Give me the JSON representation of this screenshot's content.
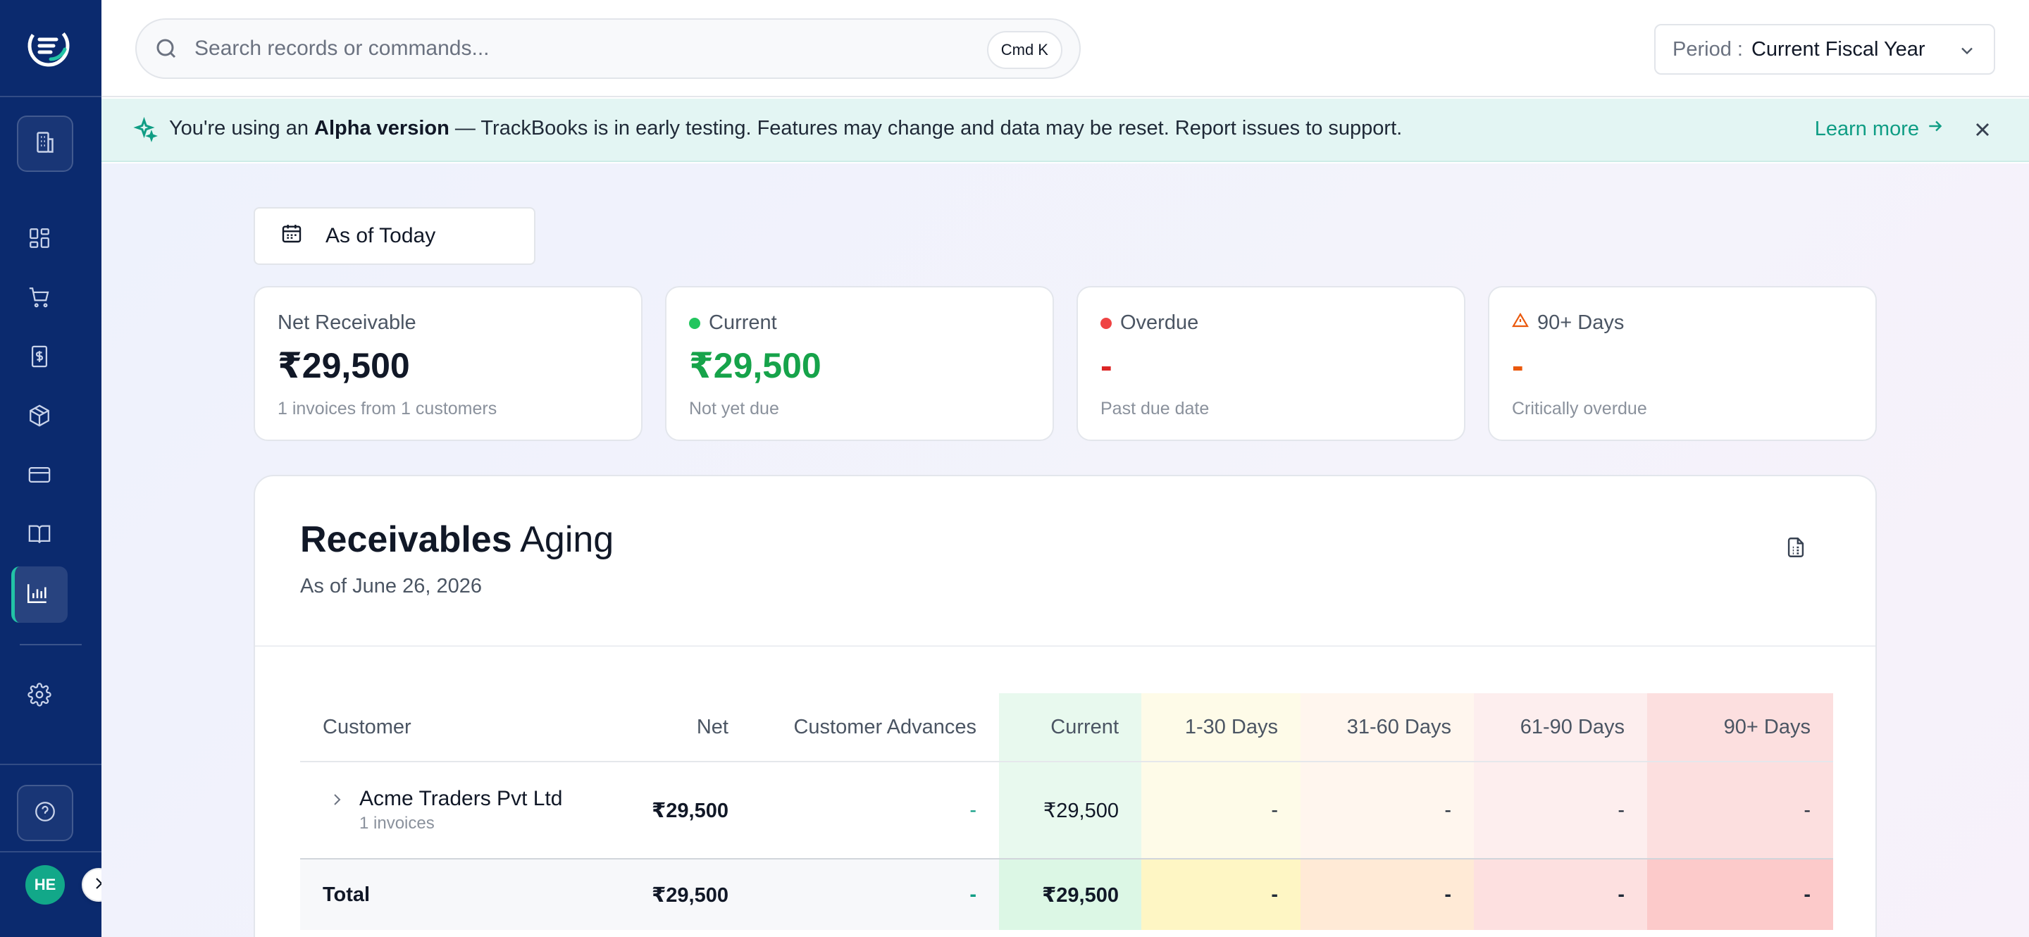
{
  "app": {
    "name": "TrackBooks",
    "user_initials": "HE"
  },
  "sidebar": {
    "items": [
      {
        "name": "organization",
        "icon": "building-icon"
      },
      {
        "name": "dashboard",
        "icon": "dashboard-grid-icon"
      },
      {
        "name": "sales",
        "icon": "shopping-cart-icon"
      },
      {
        "name": "expenses",
        "icon": "bill-dollar-icon"
      },
      {
        "name": "inventory",
        "icon": "package-icon"
      },
      {
        "name": "banking",
        "icon": "credit-card-icon"
      },
      {
        "name": "accounting",
        "icon": "book-open-icon"
      },
      {
        "name": "reports",
        "icon": "bar-chart-icon",
        "active": true
      },
      {
        "name": "settings",
        "icon": "gear-icon"
      },
      {
        "name": "help",
        "icon": "help-circle-icon"
      }
    ]
  },
  "header": {
    "search_placeholder": "Search records or commands...",
    "shortcut": "Cmd K",
    "period_label": "Period :",
    "period_value": "Current Fiscal Year"
  },
  "banner": {
    "prefix": "You're using an ",
    "bold": "Alpha version",
    "suffix": " — TrackBooks is in early testing. Features may change and data may be reset. Report issues to support.",
    "link": "Learn more"
  },
  "filter": {
    "as_of": "As of Today"
  },
  "summary_cards": [
    {
      "label": "Net Receivable",
      "value": "₹29,500",
      "sub": "1 invoices from 1 customers",
      "color": "#111827"
    },
    {
      "label": "Current",
      "value": "₹29,500",
      "sub": "Not yet due",
      "color": "#16a34a"
    },
    {
      "label": "Overdue",
      "value": "-",
      "sub": "Past due date",
      "color": "#dc2626"
    },
    {
      "label": "90+ Days",
      "value": "-",
      "sub": "Critically overdue",
      "color": "#ea580c"
    }
  ],
  "report": {
    "title_bold": "Receivables",
    "title_rest": " Aging",
    "subtitle": "As of June 26, 2026",
    "columns": [
      "Customer",
      "Net",
      "Customer Advances",
      "Current",
      "1-30 Days",
      "31-60 Days",
      "61-90 Days",
      "90+ Days"
    ],
    "rows": [
      {
        "customer": "Acme Traders Pvt Ltd",
        "sub": "1 invoices",
        "net": "₹29,500",
        "advances": "-",
        "current": "₹29,500",
        "d1_30": "-",
        "d31_60": "-",
        "d61_90": "-",
        "d90": "-"
      }
    ],
    "total": {
      "label": "Total",
      "net": "₹29,500",
      "advances": "-",
      "current": "₹29,500",
      "d1_30": "-",
      "d31_60": "-",
      "d61_90": "-",
      "d90": "-"
    }
  },
  "colors": {
    "sidebar": "#0b2a6e",
    "accent": "#0f9d84",
    "bucket_current": "#e7f9ee",
    "bucket_1_30": "#fefbe6",
    "bucket_31_60": "#fff5ec",
    "bucket_61_90": "#fdeded",
    "bucket_90": "#fcdfdf"
  }
}
